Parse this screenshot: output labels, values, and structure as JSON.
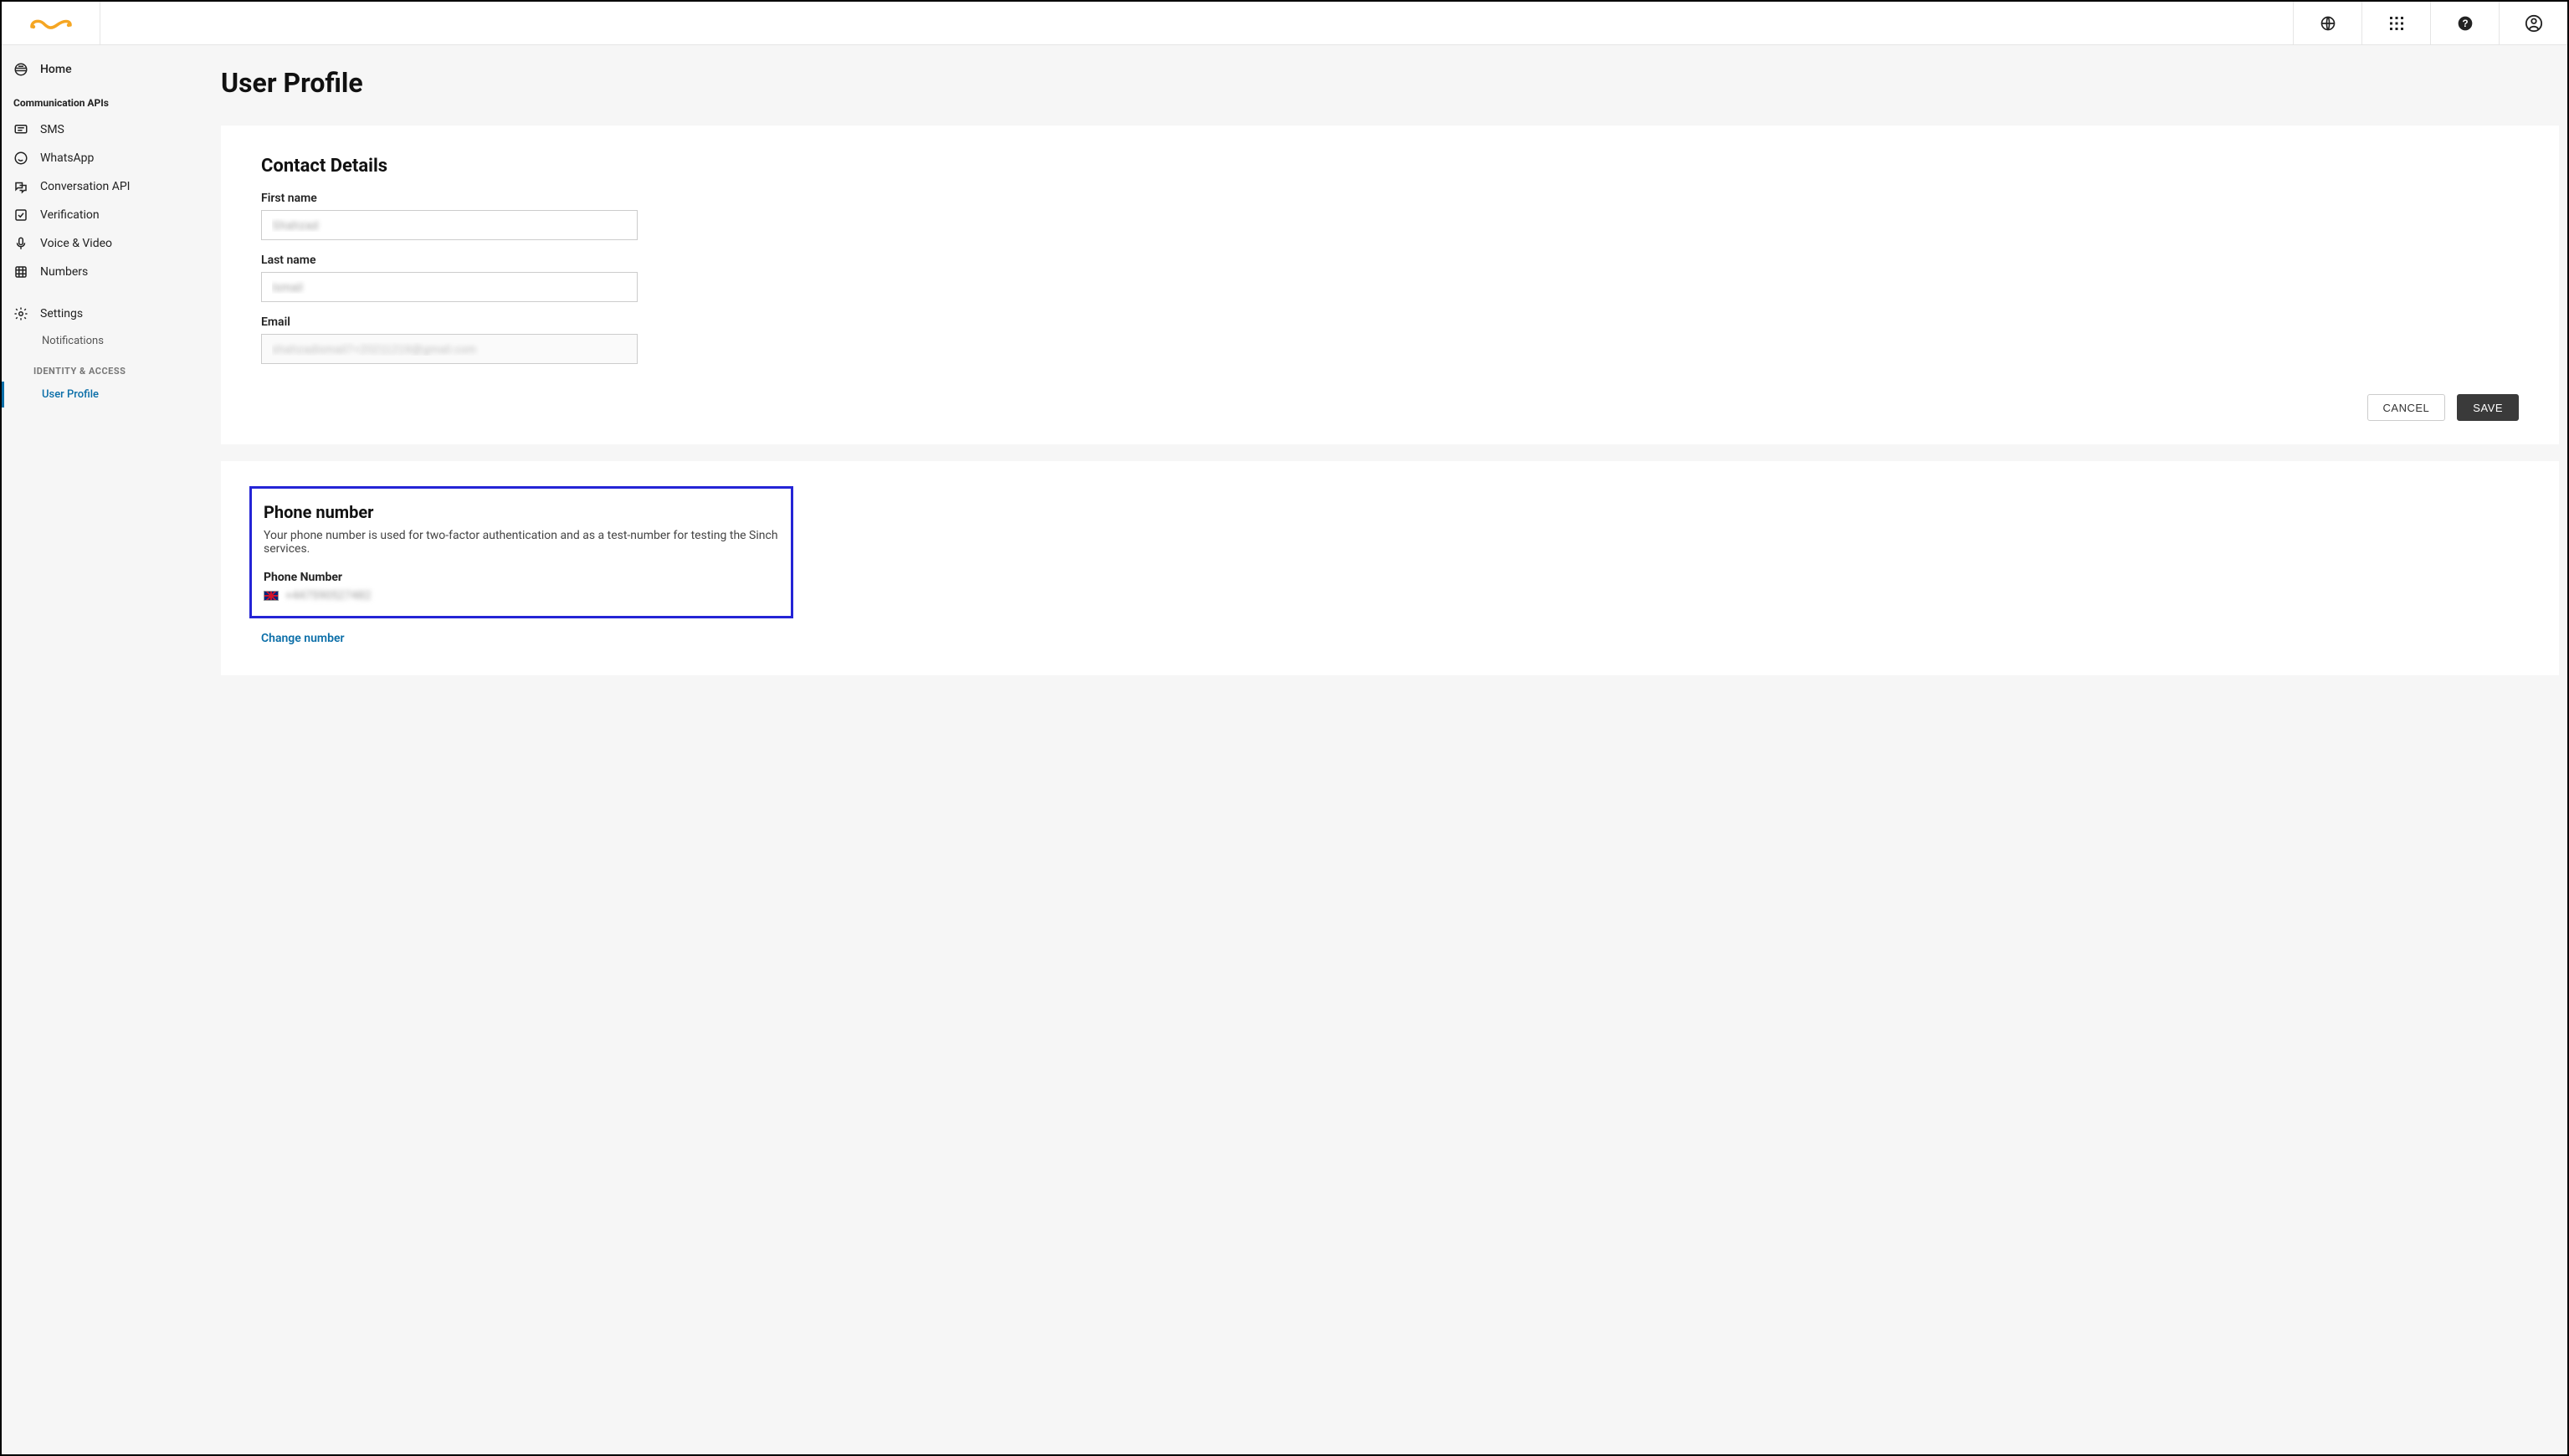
{
  "header": {
    "icons": [
      "globe",
      "apps",
      "help",
      "account"
    ]
  },
  "sidebar": {
    "home": "Home",
    "section_comm": "Communication APIs",
    "items": [
      {
        "label": "SMS"
      },
      {
        "label": "WhatsApp"
      },
      {
        "label": "Conversation API"
      },
      {
        "label": "Verification"
      },
      {
        "label": "Voice & Video"
      },
      {
        "label": "Numbers"
      }
    ],
    "settings": "Settings",
    "notifications": "Notifications",
    "identity_section": "IDENTITY & ACCESS",
    "user_profile": "User Profile"
  },
  "page": {
    "title": "User Profile"
  },
  "contact": {
    "heading": "Contact Details",
    "first_name_label": "First name",
    "first_name_value": "Shahzad",
    "last_name_label": "Last name",
    "last_name_value": "Ismail",
    "email_label": "Email",
    "email_value": "shahzadismail7+20211219@gmail.com",
    "cancel": "CANCEL",
    "save": "SAVE"
  },
  "phone": {
    "heading": "Phone number",
    "description": "Your phone number is used for two-factor authentication and as a test-number for testing the Sinch services.",
    "label": "Phone Number",
    "value": "+447590527482",
    "change": "Change number"
  }
}
